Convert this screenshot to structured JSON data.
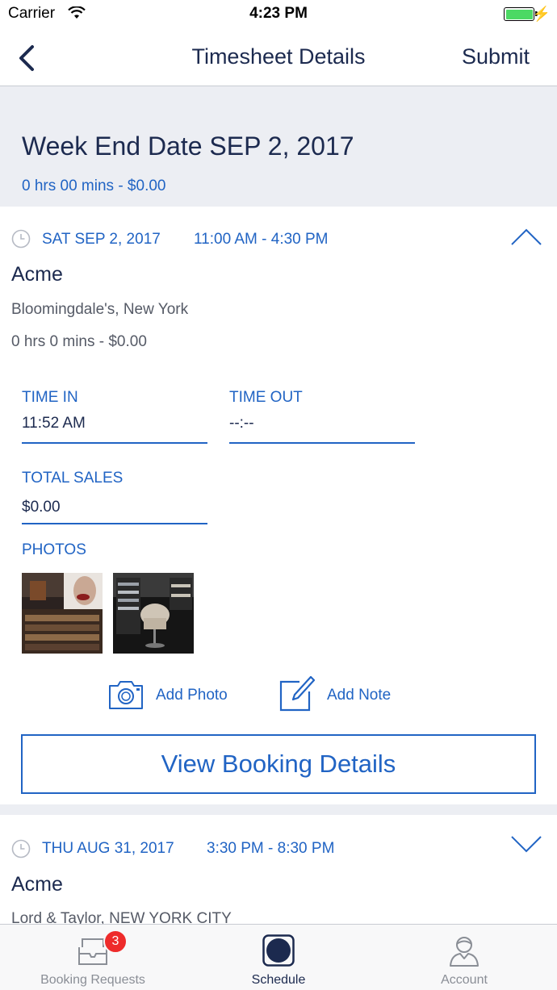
{
  "status_bar": {
    "carrier": "Carrier",
    "time": "4:23 PM"
  },
  "nav": {
    "title": "Timesheet Details",
    "submit_label": "Submit"
  },
  "week": {
    "title": "Week End Date SEP 2, 2017",
    "total": "0 hrs 00 mins - $0.00"
  },
  "shifts": [
    {
      "date": "SAT SEP 2, 2017",
      "hours": "11:00 AM - 4:30 PM",
      "client": "Acme",
      "location": "Bloomingdale's, New York",
      "duration": "0 hrs 0 mins - $0.00",
      "expanded": true,
      "time_in_label": "TIME IN",
      "time_in_value": "11:52 AM",
      "time_out_label": "TIME OUT",
      "time_out_value": "--:--",
      "total_sales_label": "TOTAL SALES",
      "total_sales_value": "$0.00",
      "photos_label": "PHOTOS",
      "add_photo_label": "Add Photo",
      "add_note_label": "Add Note",
      "view_booking_label": "View Booking Details"
    },
    {
      "date": "THU AUG 31, 2017",
      "hours": "3:30 PM - 8:30 PM",
      "client": "Acme",
      "location": "Lord & Taylor, NEW YORK CITY",
      "expanded": false
    }
  ],
  "tabbar": {
    "tabs": [
      {
        "label": "Booking Requests",
        "badge": "3",
        "icon": "envelope-icon"
      },
      {
        "label": "Schedule",
        "icon": "schedule-icon",
        "active": true
      },
      {
        "label": "Account",
        "icon": "person-icon"
      }
    ]
  },
  "colors": {
    "accent": "#2164c4",
    "navy": "#1c2a4f",
    "background": "#eceef3",
    "badge": "#ee2b2b"
  }
}
